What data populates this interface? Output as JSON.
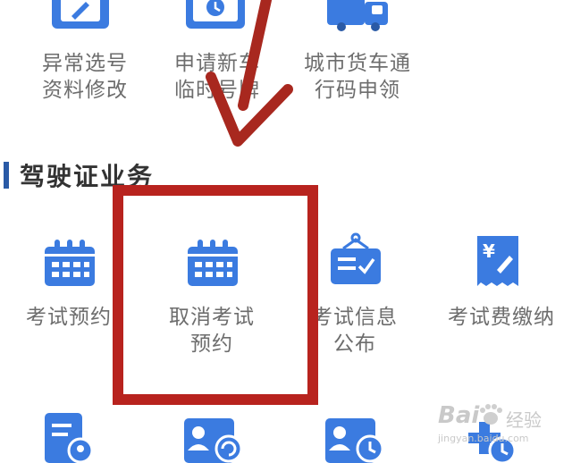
{
  "row1": [
    {
      "label_line1": "异常选号",
      "label_line2": "资料修改",
      "icon": "edit-card-icon"
    },
    {
      "label_line1": "申请新车",
      "label_line2": "临时号牌",
      "icon": "temp-plate-clock-icon"
    },
    {
      "label_line1": "城市货车通",
      "label_line2": "行码申领",
      "icon": "truck-icon"
    }
  ],
  "section": {
    "title": "驾驶证业务"
  },
  "row2": [
    {
      "label_line1": "考试预约",
      "label_line2": "",
      "icon": "calendar-icon"
    },
    {
      "label_line1": "取消考试",
      "label_line2": "预约",
      "icon": "calendar-cancel-icon"
    },
    {
      "label_line1": "考试信息",
      "label_line2": "公布",
      "icon": "notice-board-icon"
    },
    {
      "label_line1": "考试费缴纳",
      "label_line2": "",
      "icon": "receipt-yen-icon"
    }
  ],
  "row3": [
    {
      "icon": "document-person-icon"
    },
    {
      "icon": "id-card-refresh-icon"
    },
    {
      "icon": "id-card-clock-icon"
    },
    {
      "icon": "plus-clock-icon"
    }
  ],
  "watermark": {
    "brand": "Bai",
    "brand2": "经验",
    "url": "jingyan.baidu.com"
  },
  "colors": {
    "icon_blue": "#3b7be0",
    "highlight": "#b8231e",
    "arrow": "#a8281f"
  }
}
